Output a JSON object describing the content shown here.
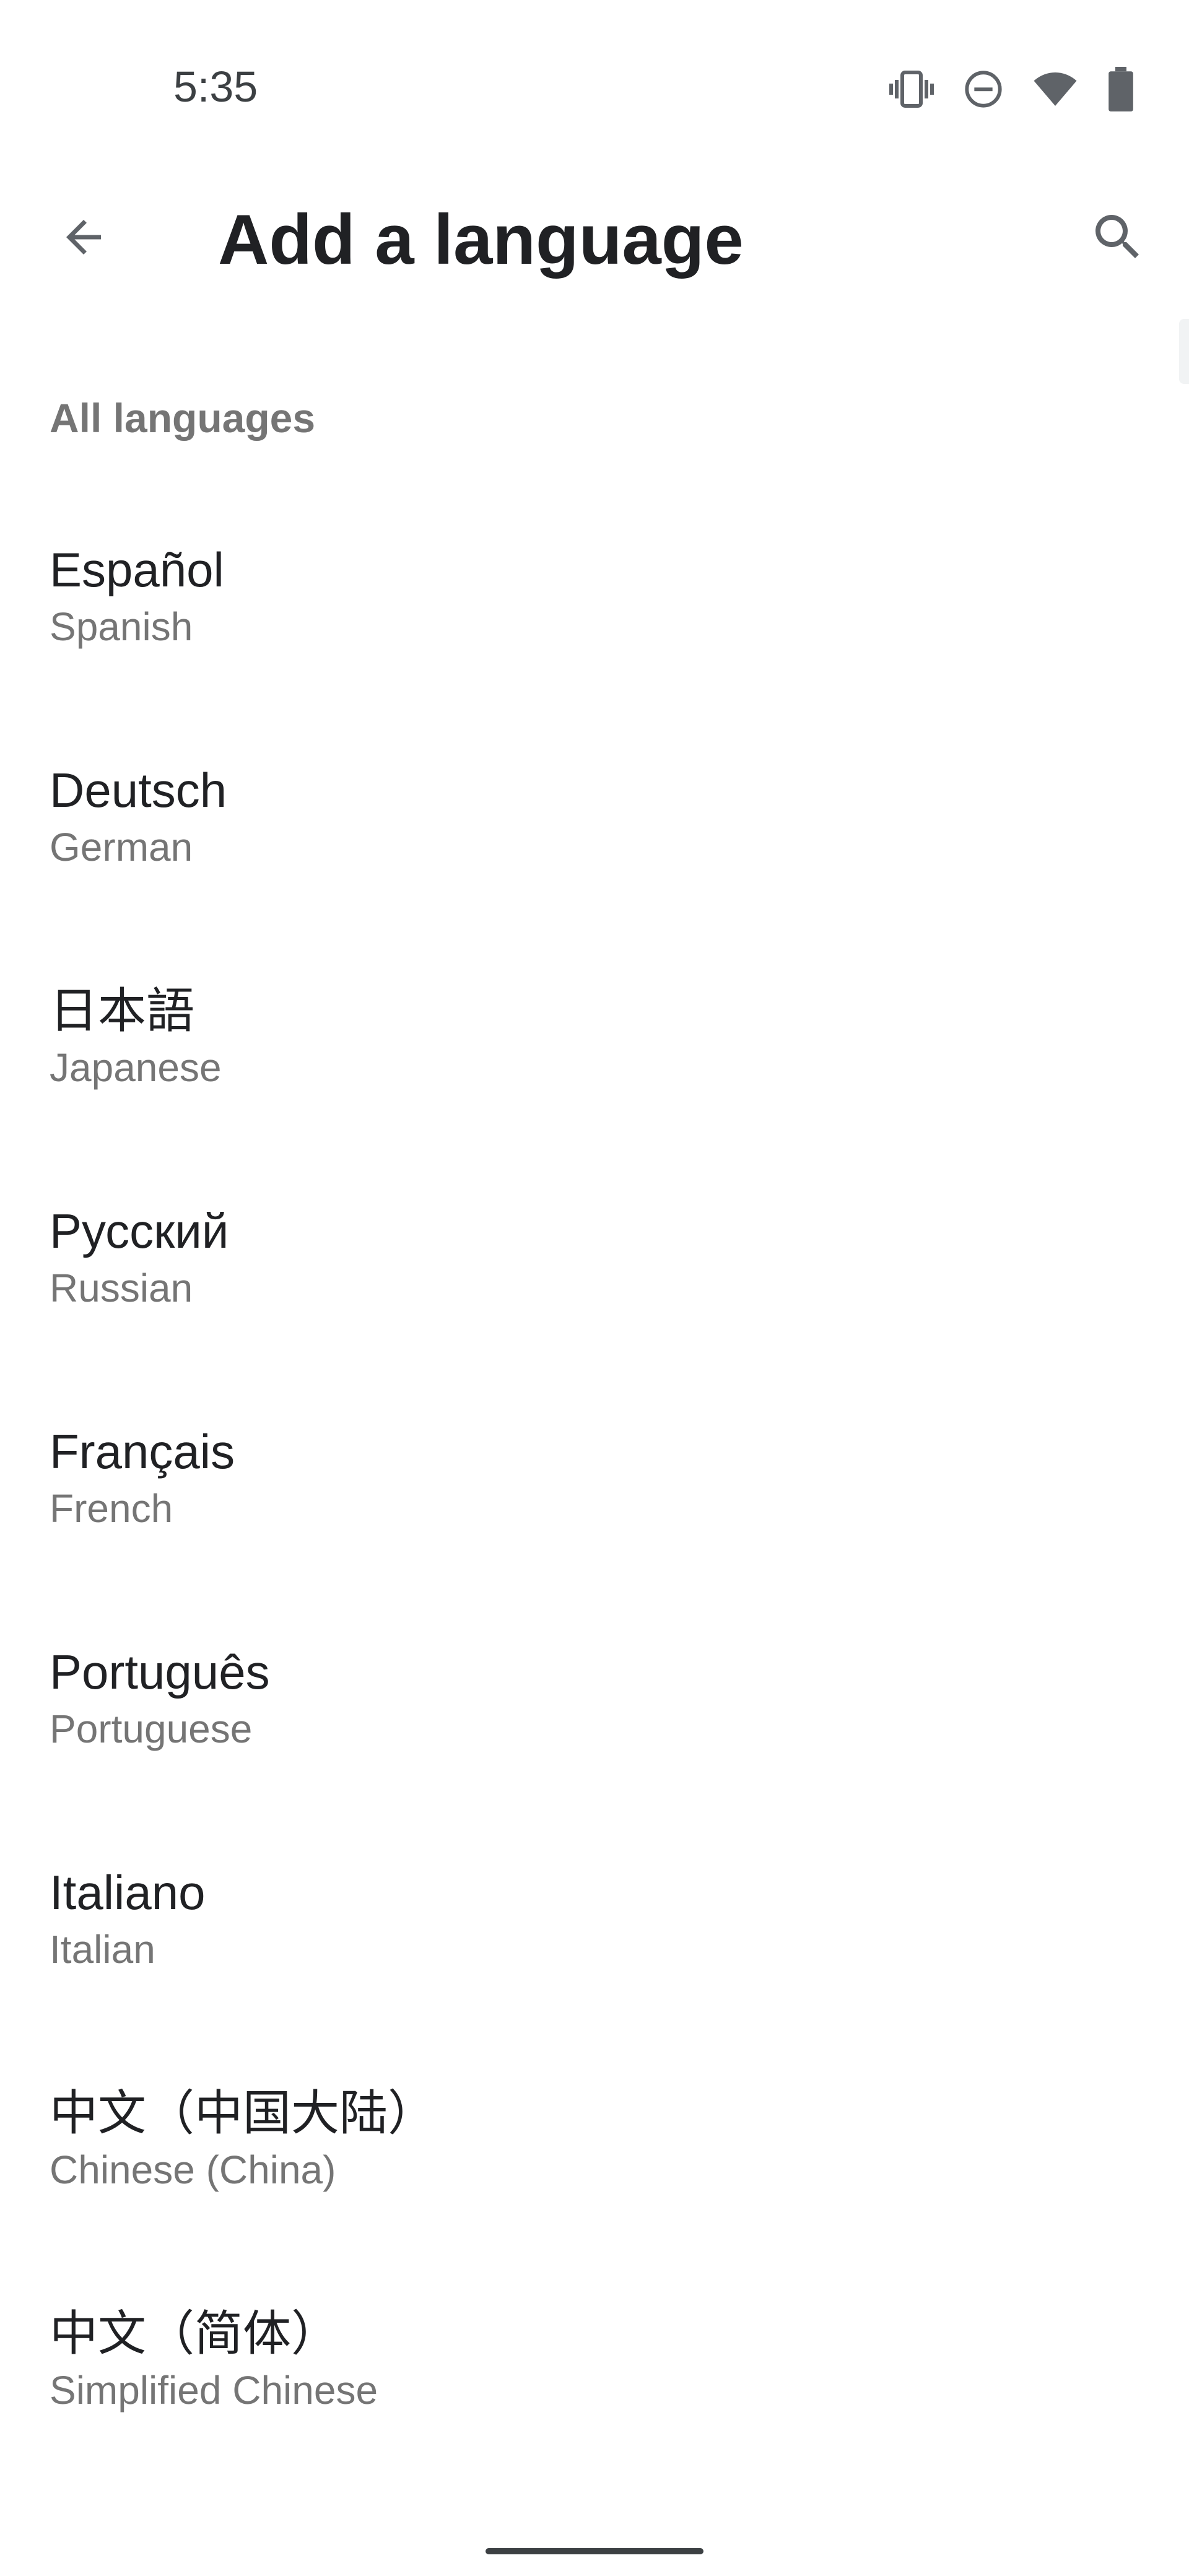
{
  "status_bar": {
    "time": "5:35",
    "icons": [
      "vibrate-icon",
      "do-not-disturb-icon",
      "wifi-icon",
      "battery-icon"
    ]
  },
  "app_bar": {
    "back_icon": "back-arrow-icon",
    "title": "Add a language",
    "search_icon": "search-icon"
  },
  "section": {
    "header": "All languages"
  },
  "languages": [
    {
      "native": "Español",
      "english": "Spanish"
    },
    {
      "native": "Deutsch",
      "english": "German"
    },
    {
      "native": "日本語",
      "english": "Japanese"
    },
    {
      "native": "Русский",
      "english": "Russian"
    },
    {
      "native": "Français",
      "english": "French"
    },
    {
      "native": "Português",
      "english": "Portuguese"
    },
    {
      "native": "Italiano",
      "english": "Italian"
    },
    {
      "native": "中文（中国大陆）",
      "english": "Chinese (China)"
    },
    {
      "native": "中文（简体）",
      "english": "Simplified Chinese"
    }
  ],
  "colors": {
    "primary_text": "#202124",
    "secondary_text": "#757575",
    "background": "#ffffff"
  }
}
